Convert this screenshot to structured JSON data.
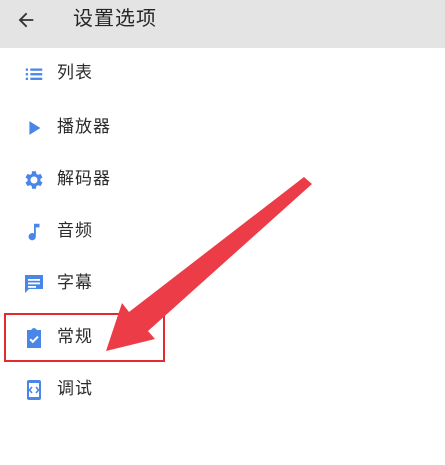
{
  "header": {
    "title": "设置选项",
    "back_icon": "arrow-left-icon"
  },
  "menu": {
    "items": [
      {
        "id": "list",
        "label": "列表",
        "icon": "list-icon"
      },
      {
        "id": "player",
        "label": "播放器",
        "icon": "play-icon"
      },
      {
        "id": "decoder",
        "label": "解码器",
        "icon": "gear-icon"
      },
      {
        "id": "audio",
        "label": "音频",
        "icon": "music-note-icon"
      },
      {
        "id": "subtitle",
        "label": "字幕",
        "icon": "subtitle-icon"
      },
      {
        "id": "general",
        "label": "常规",
        "icon": "clipboard-check-icon"
      },
      {
        "id": "debug",
        "label": "调试",
        "icon": "code-icon"
      }
    ],
    "highlighted_item": "general"
  },
  "colors": {
    "accent": "#4a86e8",
    "annotation": "#e02c2c",
    "header_bg": "#e4e4e4"
  }
}
